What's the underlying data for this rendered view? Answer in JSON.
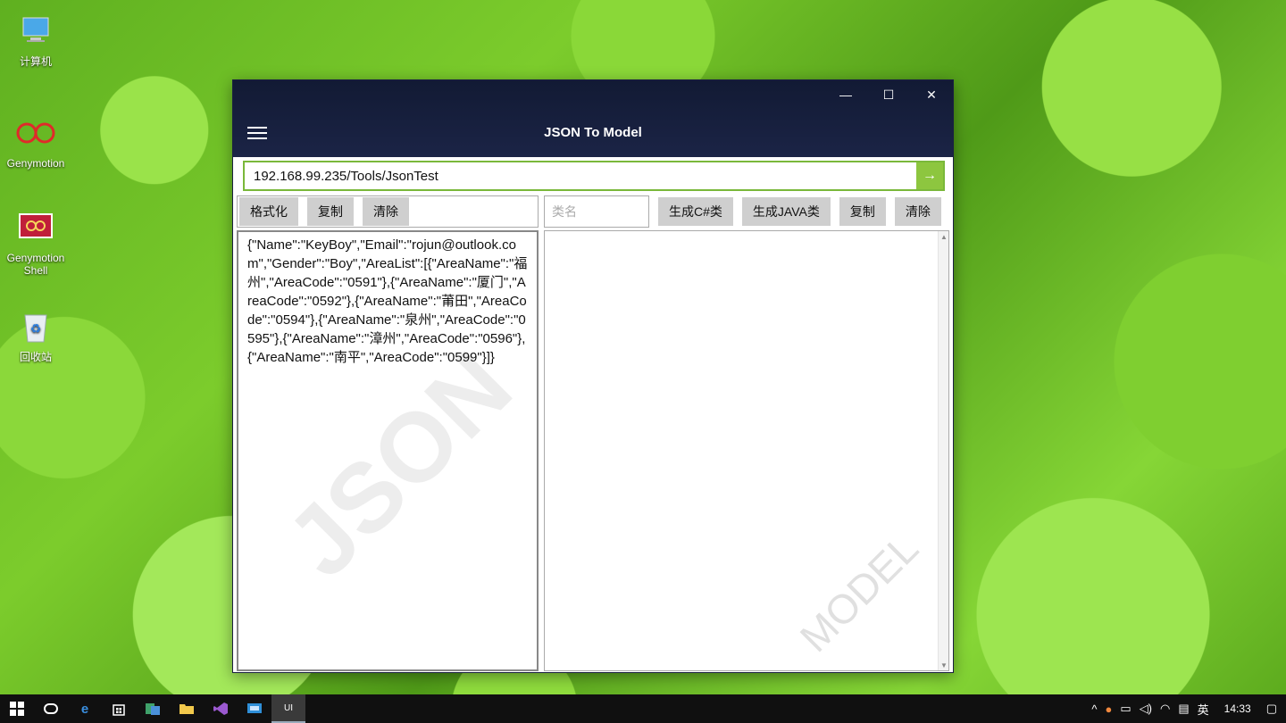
{
  "desktop": {
    "icons": [
      {
        "label": "计算机",
        "icon": "computer-icon"
      },
      {
        "label": "Genymotion",
        "icon": "genymotion-icon"
      },
      {
        "label": "Genymotion Shell",
        "icon": "genymotion-shell-icon"
      },
      {
        "label": "回收站",
        "icon": "recycle-bin-icon"
      }
    ]
  },
  "window": {
    "title": "JSON To Model",
    "controls": {
      "minimize": "—",
      "maximize": "☐",
      "close": "✕"
    },
    "url": {
      "value": "192.168.99.235/Tools/JsonTest",
      "go": "→"
    },
    "left_toolbar": {
      "format": "格式化",
      "copy": "复制",
      "clear": "清除"
    },
    "right_toolbar": {
      "class_placeholder": "类名",
      "gen_csharp": "生成C#类",
      "gen_java": "生成JAVA类",
      "copy": "复制",
      "clear": "清除"
    },
    "json_text": "{\"Name\":\"KeyBoy\",\"Email\":\"rojun@outlook.com\",\"Gender\":\"Boy\",\"AreaList\":[{\"AreaName\":\"福州\",\"AreaCode\":\"0591\"},{\"AreaName\":\"厦门\",\"AreaCode\":\"0592\"},{\"AreaName\":\"莆田\",\"AreaCode\":\"0594\"},{\"AreaName\":\"泉州\",\"AreaCode\":\"0595\"},{\"AreaName\":\"漳州\",\"AreaCode\":\"0596\"},{\"AreaName\":\"南平\",\"AreaCode\":\"0599\"}]}",
    "watermark_left": "JSON",
    "watermark_right": "MODEL"
  },
  "taskbar": {
    "items": [
      "start-icon",
      "cortana-icon",
      "edge-icon",
      "store-icon",
      "app-icon",
      "explorer-icon",
      "visual-studio-icon",
      "remote-icon",
      "uwp-app-icon"
    ],
    "active_label": "UI",
    "tray": {
      "ime": "英",
      "time": "14:33"
    }
  }
}
